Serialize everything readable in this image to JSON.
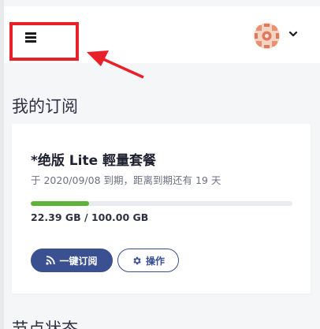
{
  "header": {
    "menu_icon": "hamburger-menu-icon",
    "avatar_icon": "avatar-pattern-icon",
    "dropdown_icon": "chevron-down-icon"
  },
  "annotation": {
    "highlight_color": "#e8202a",
    "arrow_color": "#e8202a"
  },
  "subscription": {
    "section_title": "我的订阅",
    "plan_name": "*绝版 Lite 輕量套餐",
    "expiry_text": "于 2020/09/08 到期，距离到期还有 19 天",
    "usage_text": "22.39 GB / 100.00 GB",
    "usage_fraction": 0.2239,
    "progress_color": "#5cb335",
    "subscribe_button": "一键订阅",
    "subscribe_icon": "rss-icon",
    "actions_button": "操作",
    "actions_icon": "gear-icon",
    "accent_color": "#3b5091"
  },
  "next_section": {
    "title": "节点状态"
  }
}
